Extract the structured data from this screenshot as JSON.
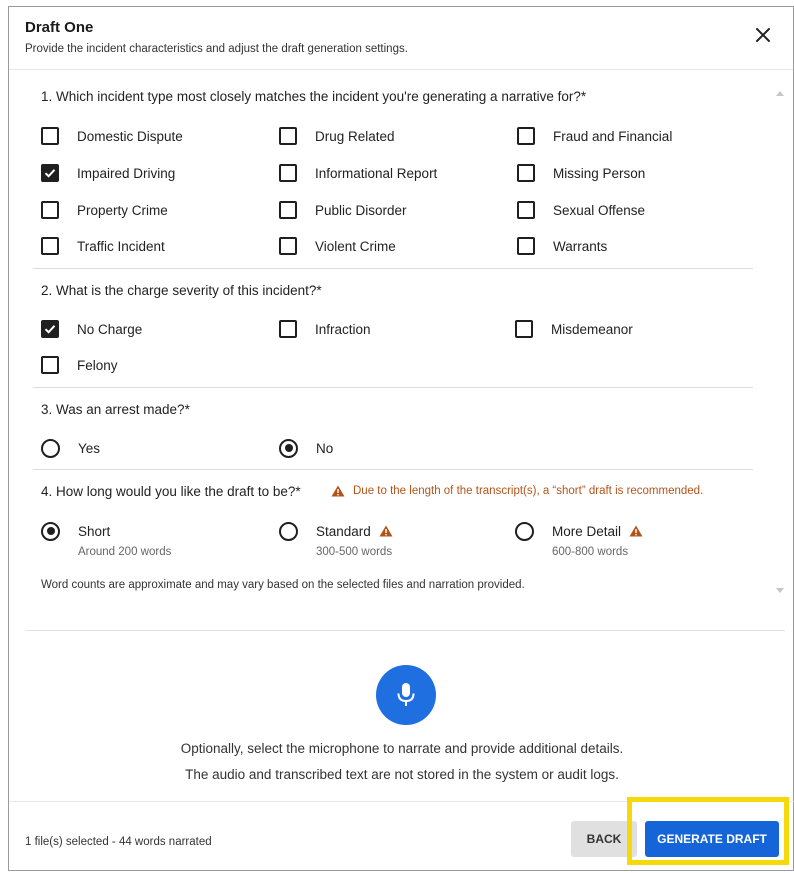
{
  "dialog": {
    "title": "Draft One",
    "subtitle": "Provide the incident characteristics and adjust the draft generation settings."
  },
  "q1": {
    "question": "1. Which incident type most closely matches the incident you're generating a narrative for?*",
    "options": [
      {
        "label": "Domestic Dispute",
        "checked": false
      },
      {
        "label": "Drug Related",
        "checked": false
      },
      {
        "label": "Fraud and Financial",
        "checked": false
      },
      {
        "label": "Impaired Driving",
        "checked": true
      },
      {
        "label": "Informational Report",
        "checked": false
      },
      {
        "label": "Missing Person",
        "checked": false
      },
      {
        "label": "Property Crime",
        "checked": false
      },
      {
        "label": "Public Disorder",
        "checked": false
      },
      {
        "label": "Sexual Offense",
        "checked": false
      },
      {
        "label": "Traffic Incident",
        "checked": false
      },
      {
        "label": "Violent Crime",
        "checked": false
      },
      {
        "label": "Warrants",
        "checked": false
      }
    ]
  },
  "q2": {
    "question": "2. What is the charge severity of this incident?*",
    "options": [
      {
        "label": "No Charge",
        "checked": true
      },
      {
        "label": "Infraction",
        "checked": false
      },
      {
        "label": "Misdemeanor",
        "checked": false
      },
      {
        "label": "Felony",
        "checked": false
      }
    ]
  },
  "q3": {
    "question": "3. Was an arrest made?*",
    "options": [
      {
        "label": "Yes",
        "selected": false
      },
      {
        "label": "No",
        "selected": true
      }
    ]
  },
  "q4": {
    "question": "4. How long would you like the draft to be?*",
    "warning": "Due to the length of the transcript(s), a “short” draft is recommended.",
    "options": [
      {
        "label": "Short",
        "sub": "Around 200 words",
        "selected": true
      },
      {
        "label": "Standard",
        "sub": "300-500 words",
        "selected": false
      },
      {
        "label": "More Detail",
        "sub": "600-800 words",
        "selected": false
      }
    ],
    "note": "Word counts are approximate and may vary based on the selected files and narration provided."
  },
  "narration": {
    "line1": "Optionally, select the microphone to narrate and provide additional details.",
    "line2": "The audio and transcribed text are not stored in the system or audit logs."
  },
  "footer": {
    "status": "1 file(s) selected - 44 words narrated",
    "back_label": "BACK",
    "generate_label": "GENERATE DRAFT"
  },
  "colors": {
    "primary": "#1565d8",
    "warning": "#b2541a",
    "highlight": "#f5d90a"
  }
}
